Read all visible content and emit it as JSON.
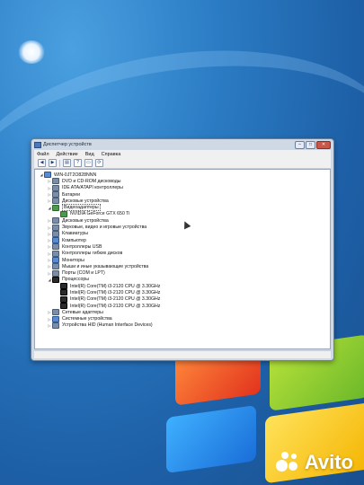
{
  "window": {
    "title": "Диспетчер устройств",
    "buttons": {
      "minimize": "–",
      "maximize": "□",
      "close": "✕"
    }
  },
  "menu": [
    "Файл",
    "Действие",
    "Вид",
    "Справка"
  ],
  "toolbar": {
    "icons": [
      "back-icon",
      "forward-icon",
      "properties-icon",
      "help-icon",
      "monitor-icon",
      "scan-hardware-icon"
    ]
  },
  "tree": {
    "root": "WIN-0JT2O828NNN",
    "dvd": "DVD и CD-ROM дисководы",
    "ide": "IDE ATA/ATAPI контроллеры",
    "battery": "Батареи",
    "disk": "Дисковые устройства",
    "video": "Видеоадаптеры",
    "gpu": "NVIDIA GeForce GTX 650 Ti",
    "diskdev": "Дисковые устройства",
    "sound": "Звуковые, видео и игровые устройства",
    "keyboards": "Клавиатуры",
    "computer": "Компьютер",
    "usb": "Контроллеры USB",
    "floppy": "Контроллеры гибких дисков",
    "monitors": "Мониторы",
    "mice": "Мыши и иные указывающие устройства",
    "ports": "Порты (COM и LPT)",
    "processors": "Процессоры",
    "cpu1": "Intel(R) Core(TM) i3-2120 CPU @ 3.30GHz",
    "cpu2": "Intel(R) Core(TM) i3-2120 CPU @ 3.30GHz",
    "cpu3": "Intel(R) Core(TM) i3-2120 CPU @ 3.30GHz",
    "cpu4": "Intel(R) Core(TM) i3-2120 CPU @ 3.30GHz",
    "network": "Сетевые адаптеры",
    "system": "Системные устройства",
    "hid": "Устройства HID (Human Interface Devices)"
  },
  "watermark": {
    "brand": "Avito"
  }
}
